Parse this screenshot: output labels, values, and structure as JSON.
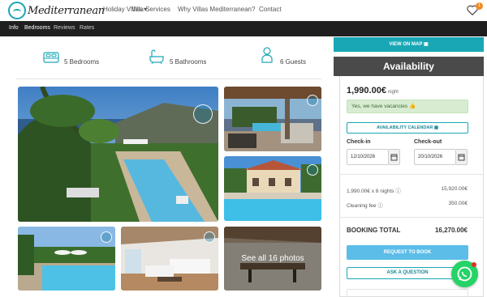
{
  "header": {
    "logo_text": "Mediterranean",
    "nav": [
      {
        "label": "Holiday Villas ▾"
      },
      {
        "label": "Villa Services"
      },
      {
        "label": "Why Villas Mediterranean?"
      },
      {
        "label": "Contact"
      }
    ],
    "favorites_count": "1"
  },
  "subnav": {
    "tabs": [
      {
        "label": "Info"
      },
      {
        "label": "Bedrooms"
      },
      {
        "label": "Reviews"
      },
      {
        "label": "Rates"
      }
    ]
  },
  "features": [
    {
      "icon": "bed-icon",
      "label": "5 Bedrooms"
    },
    {
      "icon": "bathtub-icon",
      "label": "5 Bathrooms"
    },
    {
      "icon": "person-icon",
      "label": "6 Guests"
    }
  ],
  "gallery": {
    "see_all_label": "See all 16 photos"
  },
  "booking": {
    "map_button": "VIEW ON MAP",
    "availability_title": "Availability",
    "price": "1,990.00€",
    "price_unit": "night",
    "vacancy_text": "Yes, we have vacancies 👍",
    "calendar_button": "AVAILABILITY CALENDAR",
    "checkin_label": "Check-in",
    "checkin_value": "12/10/2026",
    "checkout_label": "Check-out",
    "checkout_value": "20/10/2026",
    "nights_label": "1,990.00€ x 8 nights",
    "nights_value": "15,920.00€",
    "cleaning_label": "Cleaning fee",
    "cleaning_value": "350.00€",
    "total_label": "BOOKING TOTAL",
    "total_value": "16,270.00€",
    "request_button": "REQUEST TO BOOK",
    "ask_button": "ASK A QUESTION"
  },
  "colors": {
    "accent": "#1aa7b5",
    "dark_bar": "#1f1f1f",
    "availability_header": "#4a4a4a",
    "whatsapp": "#25d366"
  }
}
